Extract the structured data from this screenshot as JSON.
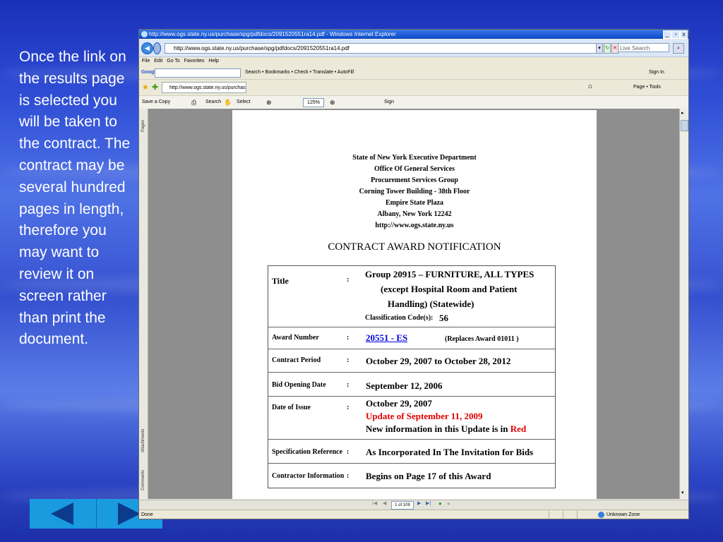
{
  "slide": {
    "body_text": "Once the link on the results page is selected you will be taken to the contract. The contract may be several hundred pages in length, therefore you may want to review it on screen rather than print the document."
  },
  "nav": {
    "prev_icon": "previous-slide-triangle",
    "next_icon": "next-slide-triangle",
    "button_color": "#1a9be0"
  },
  "browser": {
    "title": "http://www.ogs.state.ny.us/purchase/spg/pdfdocs/2091520551ra14.pdf - Windows Internet Explorer",
    "address": "http://www.ogs.state.ny.us/purchase/spg/pdfdocs/2091520551ra14.pdf",
    "search_placeholder": "Live Search",
    "menu": [
      "File",
      "Edit",
      "Go To",
      "Favorites",
      "Help"
    ],
    "google_bar": {
      "logo": "Google",
      "items": "Search • Bookmarks • Check • Translate • AutoFill",
      "sign_in": "Sign In"
    },
    "tab_label": "http://www.ogs.state.ny.us/purchase/spg...",
    "toolbar_right": "Page • Tools",
    "pdf_toolbar": {
      "save": "Save a Copy",
      "search": "Search",
      "select": "Select",
      "zoom": "125%",
      "sign": "Sign"
    },
    "side_panels": [
      "Pages",
      "Attachments",
      "Comments"
    ],
    "page_indicator": "1 of 109",
    "status": "Done",
    "zone": "Unknown Zone"
  },
  "document": {
    "header_lines": [
      "State of New York Executive Department",
      "Office Of General Services",
      "Procurement Services Group",
      "Corning Tower Building - 38th Floor",
      "Empire State Plaza",
      "Albany, New York  12242",
      "http://www.ogs.state.ny.us"
    ],
    "heading": "CONTRACT AWARD NOTIFICATION",
    "rows": {
      "title": {
        "label": "Title",
        "line1": "Group 20915 – FURNITURE, ALL TYPES",
        "line2": "(except Hospital Room and Patient",
        "line3": "Handling) (Statewide)",
        "class_label": "Classification Code(s):",
        "class_value": "56"
      },
      "award": {
        "label": "Award Number",
        "link": "20551 - ES",
        "replaces": "(Replaces Award 01011 )"
      },
      "period": {
        "label": "Contract Period",
        "value": "October 29, 2007 to October 28, 2012"
      },
      "bid": {
        "label": "Bid Opening Date",
        "value": "September 12, 2006"
      },
      "issue": {
        "label": "Date of Issue",
        "date": "October 29, 2007",
        "update": "Update of September 11, 2009",
        "note": "New information in this Update is in",
        "note_red": "Red"
      },
      "spec": {
        "label": "Specification Reference",
        "value": "As Incorporated In The Invitation for Bids"
      },
      "contractor": {
        "label": "Contractor Information",
        "value": "Begins on Page 17 of this Award"
      }
    },
    "colon": ":"
  }
}
